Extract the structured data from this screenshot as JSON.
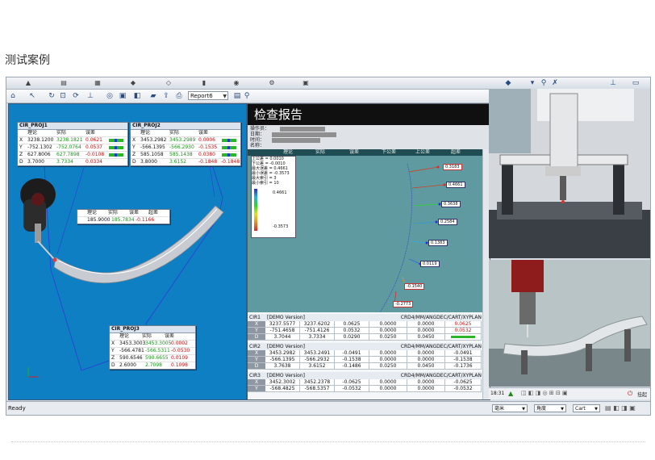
{
  "page": {
    "heading": "测试案例"
  },
  "toolbar": {
    "report_combo": "Report6"
  },
  "viewport": {
    "boxes": [
      {
        "title": "CIR_PROJ1",
        "headers": [
          "理论",
          "实际",
          "误差"
        ],
        "rows": [
          {
            "axis": "X",
            "nominal": "3238.1200",
            "actual": "3238.1821",
            "dev": "0.0621",
            "out": ""
          },
          {
            "axis": "Y",
            "nominal": "-752.1302",
            "actual": "-752.0764",
            "dev": "0.0537",
            "out": ""
          },
          {
            "axis": "Z",
            "nominal": "627.8006",
            "actual": "627.7898",
            "dev": "-0.0108",
            "out": ""
          },
          {
            "axis": "D",
            "nominal": "3.7000",
            "actual": "3.7334",
            "dev": "0.0334",
            "out": "0.0334"
          }
        ]
      },
      {
        "title": "CIR_PROJ2",
        "headers": [
          "理论",
          "实际",
          "误差"
        ],
        "rows": [
          {
            "axis": "X",
            "nominal": "3453.2982",
            "actual": "3453.2989",
            "dev": "0.0006",
            "out": ""
          },
          {
            "axis": "Y",
            "nominal": "-566.1395",
            "actual": "-566.2930",
            "dev": "-0.1535",
            "out": ""
          },
          {
            "axis": "Z",
            "nominal": "585.1058",
            "actual": "585.1438",
            "dev": "0.0380",
            "out": ""
          },
          {
            "axis": "D",
            "nominal": "3.8000",
            "actual": "3.6152",
            "dev": "-0.1848",
            "out": "-0.1848"
          }
        ]
      },
      {
        "title": "CIR_PROJ3",
        "headers": [
          "理论",
          "实际",
          "误差"
        ],
        "rows": [
          {
            "axis": "X",
            "nominal": "3453.3003",
            "actual": "3453.3005",
            "dev": "0.0002",
            "out": ""
          },
          {
            "axis": "Y",
            "nominal": "-566.4781",
            "actual": "-566.5311",
            "dev": "-0.0530",
            "out": ""
          },
          {
            "axis": "Z",
            "nominal": "590.6546",
            "actual": "590.6655",
            "dev": "0.0109",
            "out": ""
          },
          {
            "axis": "D",
            "nominal": "2.6000",
            "actual": "2.7098",
            "dev": "0.1098",
            "out": "0.1098"
          }
        ]
      }
    ],
    "mini_box": {
      "headers": [
        "理论",
        "实际",
        "误差",
        "超差"
      ],
      "nominal": "185.9000",
      "actual": "185.7834",
      "dev": "-0.1166"
    }
  },
  "report": {
    "title": "检查报告",
    "meta_labels": [
      "操作员：",
      "日期：",
      "时间：",
      "名称："
    ],
    "plot_headers": [
      "理论",
      "实际",
      "误差",
      "下公差",
      "上公差",
      "超差"
    ],
    "legend_lines": [
      "上公差 = 0.0010",
      "下公差 = -0.0010",
      "最大误差 = 0.4661",
      "最小误差 = -0.3573",
      "最大索引 = 3",
      "最小索引 = 10"
    ],
    "legend_max": "0.4661",
    "legend_min": "-0.3573",
    "point_labels": [
      "0.3183",
      "0.4661",
      "0.3638",
      "0.2584",
      "0.1383",
      "0.0119",
      "-0.1540",
      "-0.2773"
    ],
    "tables": [
      {
        "name": "CIR1",
        "version": "[DEMO Version]",
        "mode": "CRD4/MM/ANGDEC/CART/XYPLAN",
        "rows": [
          {
            "ax": "X",
            "v": [
              "3237.5577",
              "3237.6202",
              "0.0625",
              "0.0000",
              "0.0000",
              "0.0625"
            ]
          },
          {
            "ax": "Y",
            "v": [
              "-751.4658",
              "-751.4126",
              "0.0532",
              "0.0000",
              "0.0000",
              "0.0532"
            ]
          },
          {
            "ax": "D",
            "v": [
              "3.7044",
              "3.7334",
              "0.0290",
              "0.0250",
              "0.0450",
              ""
            ]
          }
        ]
      },
      {
        "name": "CIR2",
        "version": "[DEMO Version]",
        "mode": "CRD4/MM/ANGDEC/CART/XYPLAN",
        "rows": [
          {
            "ax": "X",
            "v": [
              "3453.2982",
              "3453.2491",
              "-0.0491",
              "0.0000",
              "0.0000",
              "-0.0491"
            ]
          },
          {
            "ax": "Y",
            "v": [
              "-566.1395",
              "-566.2932",
              "-0.1538",
              "0.0000",
              "0.0000",
              "-0.1538"
            ]
          },
          {
            "ax": "D",
            "v": [
              "3.7638",
              "3.6152",
              "-0.1486",
              "0.0250",
              "0.0450",
              "-0.1736"
            ]
          }
        ]
      },
      {
        "name": "CIR3",
        "version": "[DEMO Version]",
        "mode": "CRD4/MM/ANGDEC/CART/XYPLAN",
        "rows": [
          {
            "ax": "X",
            "v": [
              "3452.3002",
              "3452.2378",
              "-0.0625",
              "0.0000",
              "0.0000",
              "-0.0625"
            ]
          },
          {
            "ax": "Y",
            "v": [
              "-568.4825",
              "-568.5357",
              "-0.0532",
              "0.0000",
              "0.0000",
              "-0.0532"
            ]
          }
        ]
      }
    ]
  },
  "right_panel": {
    "time": "18:31",
    "exit_label": "挂起"
  },
  "status_bar": {
    "ready": "Ready",
    "units": "毫米",
    "angle": "角度",
    "coord": "Cart"
  },
  "colors": {
    "viewport_bg": "#0f7fc3",
    "report_plot_bg": "#5f9aa1",
    "report_head_bg": "#101010"
  }
}
